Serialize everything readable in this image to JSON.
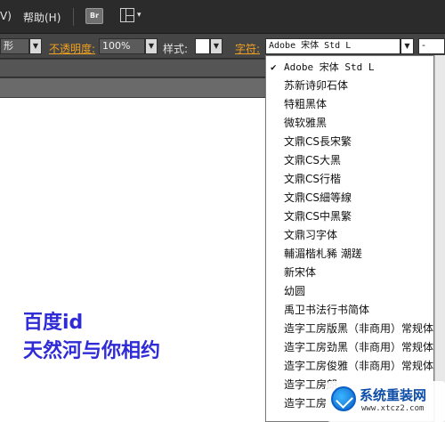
{
  "menubar": {
    "view_fragment": "V)",
    "help_label": "帮助(H)",
    "bridge_label": "Br",
    "layout_caret": "▾"
  },
  "controlbar": {
    "shape_fragment": "形",
    "opacity_label": "不透明度:",
    "opacity_value": "100%",
    "style_label": "样式:",
    "font_label": "字符:",
    "font_value": "Adobe 宋体 Std L",
    "size_value": "-",
    "dropdown_glyph": "▼"
  },
  "canvas": {
    "line1": "百度id",
    "line2": "天然河与你相约"
  },
  "font_list": {
    "check_glyph": "✔",
    "items": [
      "Adobe 宋体 Std L",
      "苏新诗卯石体",
      "特粗黑体",
      "微软雅黑",
      "文鼎CS長宋繁",
      "文鼎CS大黑",
      "文鼎CS行楷",
      "文鼎CS細等線",
      "文鼎CS中黑繁",
      "文鼎习字体",
      "輔湄楷札豨  潮蹉",
      "新宋体",
      "幼圆",
      "禹卫书法行书简体",
      "造字工房版黑（非商用）常规体",
      "造字工房劲黑（非商用）常规体",
      "造字工房俊雅（非商用）常规体",
      "造字工房朗",
      "造字工房"
    ]
  },
  "watermark": {
    "title": "系统重装网",
    "url": "www.xtcz2.com"
  }
}
